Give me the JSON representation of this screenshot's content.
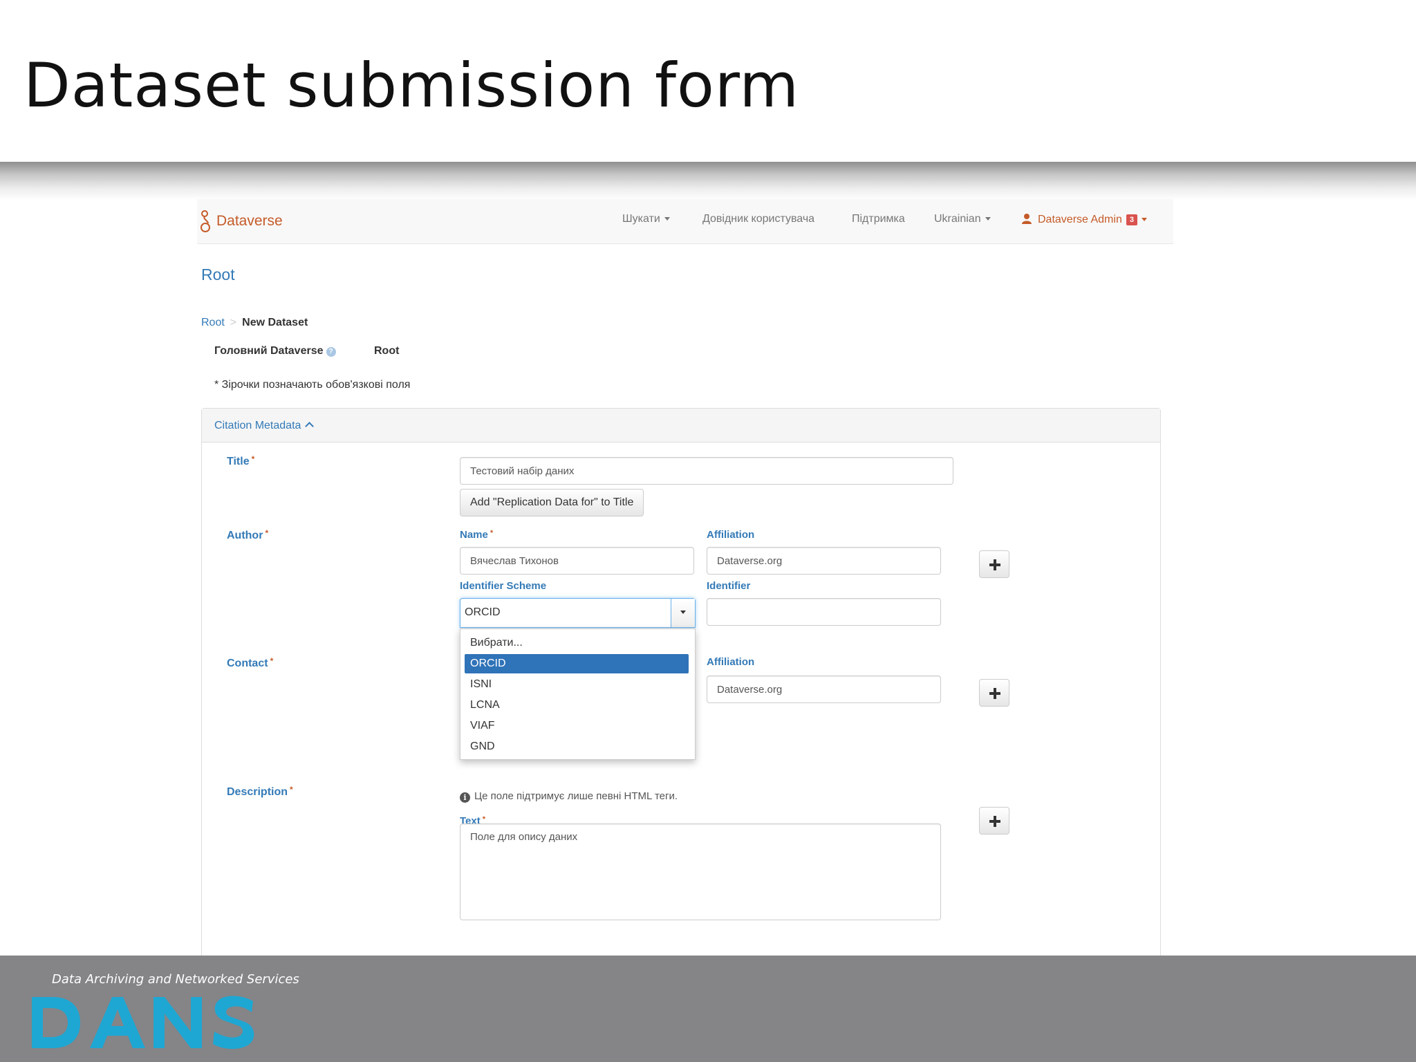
{
  "slide": {
    "title": "Dataset submission form"
  },
  "navbar": {
    "brand": "Dataverse",
    "items": [
      {
        "label": "Шукати"
      },
      {
        "label": "Довідник користувача"
      },
      {
        "label": "Підтримка"
      },
      {
        "label": "Ukrainian"
      }
    ],
    "user": {
      "label": "Dataverse Admin",
      "badge": "3"
    }
  },
  "page": {
    "root_title": "Root",
    "breadcrumb": {
      "parent": "Root",
      "separator": ">",
      "current": "New Dataset"
    },
    "host": {
      "label": "Головний Dataverse",
      "help": "?",
      "value": "Root"
    },
    "required_note": "* Зірочки позначають обов'язкові поля"
  },
  "citation": {
    "heading": "Citation Metadata",
    "required_mark": "*",
    "title": {
      "label": "Title",
      "value": "Тестовий набір даних",
      "add_button": "Add \"Replication Data for\" to Title"
    },
    "author": {
      "label": "Author",
      "name_label": "Name",
      "name_value": "Вячеслав Тихонов",
      "affiliation_label": "Affiliation",
      "affiliation_value": "Dataverse.org",
      "scheme_label": "Identifier Scheme",
      "scheme_value": "ORCID",
      "identifier_label": "Identifier",
      "identifier_value": ""
    },
    "scheme_options": [
      "Вибрати...",
      "ORCID",
      "ISNI",
      "LCNA",
      "VIAF",
      "GND"
    ],
    "contact": {
      "label": "Contact",
      "affiliation_label": "Affiliation",
      "affiliation_value": "Dataverse.org"
    },
    "description": {
      "label": "Description",
      "note": "Це поле підтримує лише певні HTML теги.",
      "text_label": "Text",
      "text_value": "Поле для опису даних"
    }
  },
  "footer": {
    "tagline": "Data Archiving and Networked Services",
    "logo": "DANS"
  },
  "colors": {
    "brand": "#c55b28",
    "link": "#337ab7",
    "selected": "#2f73b8",
    "dans_logo": "#1ea7d3",
    "footer_bg": "#858487"
  }
}
